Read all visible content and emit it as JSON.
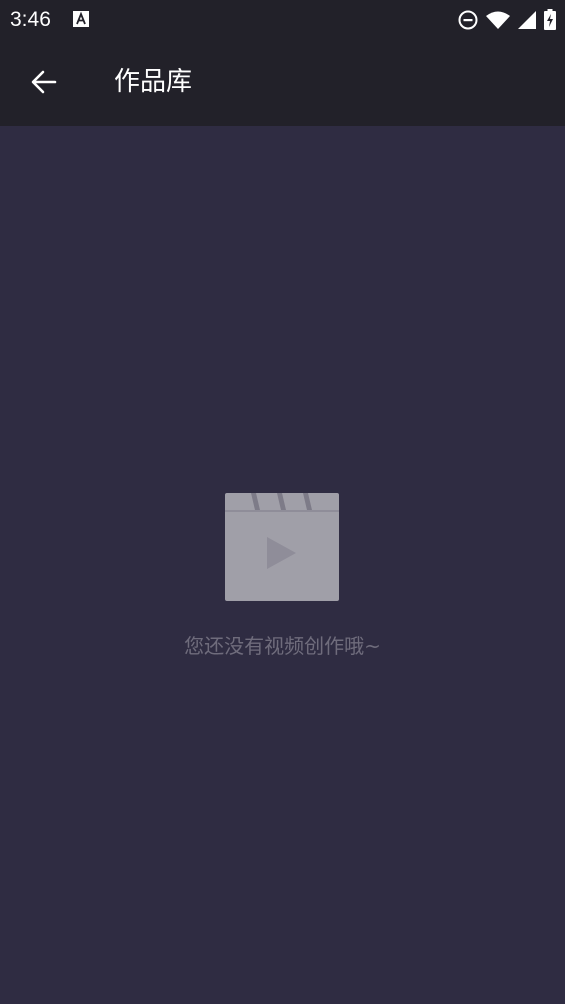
{
  "status_bar": {
    "time": "3:46",
    "left_icon": "font-a-notification-icon",
    "right_icons": [
      "do-not-disturb-icon",
      "wifi-icon",
      "cellular-signal-icon",
      "battery-charging-icon"
    ]
  },
  "app_bar": {
    "back_icon": "arrow-left-icon",
    "title": "作品库"
  },
  "empty_state": {
    "icon": "video-clapperboard-icon",
    "message": "您还没有视频创作哦~"
  },
  "colors": {
    "status_bar_bg": "#222129",
    "app_bar_bg": "#222129",
    "content_bg": "#2f2c42",
    "empty_icon_fill": "#a09fa8",
    "empty_text": "#6f6c7c",
    "title_text": "#ffffff"
  }
}
